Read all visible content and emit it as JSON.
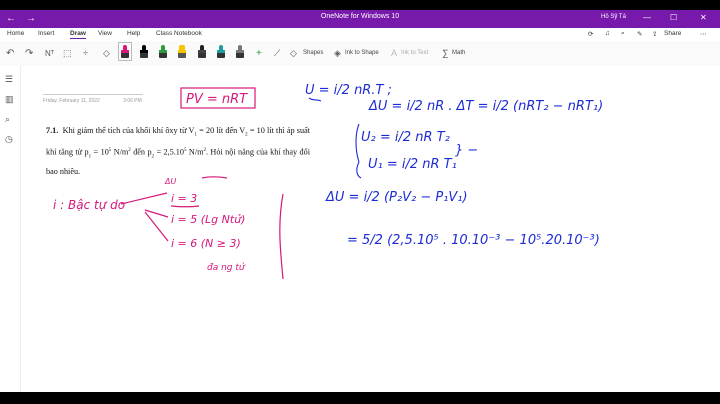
{
  "window": {
    "title": "OneNote for Windows 10",
    "user": "Hồ Sỹ Tá",
    "colors": {
      "titlebar": "#7719aa",
      "ink_red": "#d6187a",
      "ink_blue": "#1c2bd6"
    }
  },
  "menu": {
    "tabs": [
      "Home",
      "Insert",
      "Draw",
      "View",
      "Help",
      "Class Notebook"
    ],
    "active_tab": "Draw",
    "share_label": "Share"
  },
  "ribbon": {
    "shapes_label": "Shapes",
    "ink_to_shape_label": "Ink to Shape",
    "ink_to_text_label": "Ink to Text",
    "math_label": "Math"
  },
  "page": {
    "date": "Friday, February 11, 2022",
    "time": "3:06 PM"
  },
  "problem": {
    "number": "7.1.",
    "text_1": "Khi giảm thể tích của khối khí ôxy từ V",
    "text_1b": " = 20 lít đến V",
    "text_2": " = 10 lít thì áp suất khí tăng từ p",
    "text_2b": " = 10",
    "text_2c": " N/m",
    "text_2d": " đến p",
    "text_3": " = 2,5.10",
    "text_3b": " N/m",
    "text_3c": ". Hỏi nội năng của khí thay đổi bao nhiêu."
  },
  "ink": {
    "formula_box": "PV = nRT",
    "delta_u_mark": "ΔU",
    "note_i": "i : Bậc tự do",
    "i3": "i = 3",
    "i5": "i = 5 (Lg Ntử)",
    "i6": "i = 6 (N ≥ 3)",
    "da_ng_tu": "đa ng tử",
    "u_eq": "U = i/2 nR.T ;",
    "delta_eq": "ΔU = i/2 nR . ΔT = i/2 (nRT₂ − nRT₁)",
    "u2": "U₂ = i/2 nR T₂",
    "u1": "U₁ = i/2 nR T₁",
    "brace_minus": "} −",
    "delta_p": "ΔU = i/2 (P₂V₂ − P₁V₁)",
    "numeric": "= 5/2 (2,5.10⁵ . 10.10⁻³ − 10⁵.20.10⁻³)"
  }
}
